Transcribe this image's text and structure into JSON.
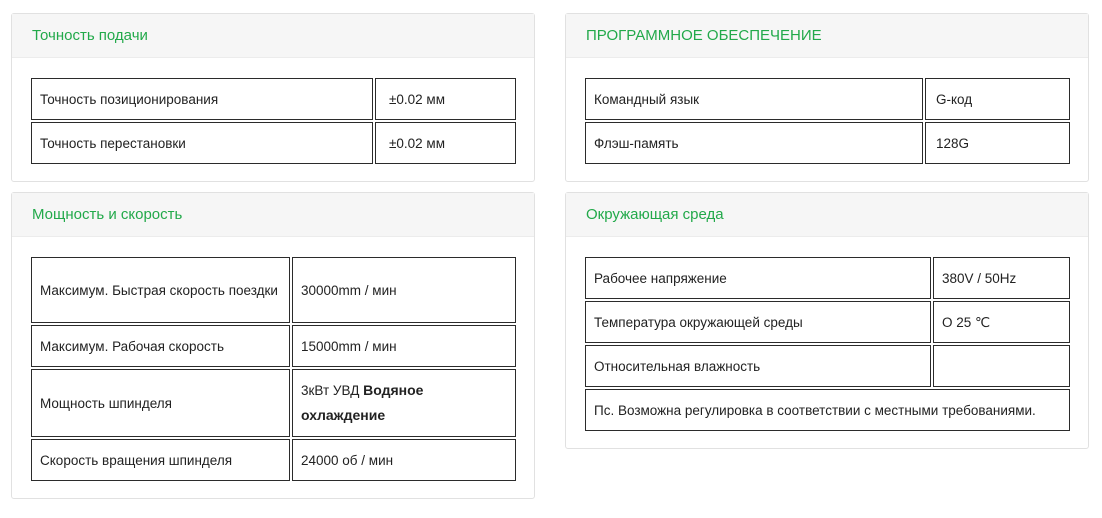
{
  "panels": {
    "feed_accuracy": {
      "title": "Точность подачи",
      "rows": [
        {
          "label": "Точность позиционирования",
          "value": "±0.02 мм"
        },
        {
          "label": "Точность перестановки",
          "value": "±0.02 мм"
        }
      ]
    },
    "software": {
      "title": "ПРОГРАММНОЕ ОБЕСПЕЧЕНИЕ",
      "rows": [
        {
          "label": "Командный язык",
          "value": "G-код"
        },
        {
          "label": "Флэш-память",
          "value": "128G"
        }
      ]
    },
    "power_speed": {
      "title": "Мощность и скорость",
      "rows": [
        {
          "label": "Максимум. Быстрая скорость поездки",
          "value": "30000mm / мин"
        },
        {
          "label": "Максимум. Рабочая скорость",
          "value": "15000mm / мин"
        },
        {
          "label": "Мощность шпинделя",
          "value_prefix": "3кВт УВД",
          "value_bold": "Водяное охлаждение"
        },
        {
          "label": "Скорость вращения шпинделя",
          "value": "24000 об / мин"
        }
      ]
    },
    "environment": {
      "title": "Окружающая среда",
      "rows": [
        {
          "label": "Рабочее напряжение",
          "value": "380V / 50Hz"
        },
        {
          "label": "Температура окружающей среды",
          "value": "O 25 ℃"
        },
        {
          "label": "Относительная влажность",
          "value": ""
        }
      ],
      "note": "Пс. Возможна регулировка в соответствии с местными требованиями."
    }
  }
}
